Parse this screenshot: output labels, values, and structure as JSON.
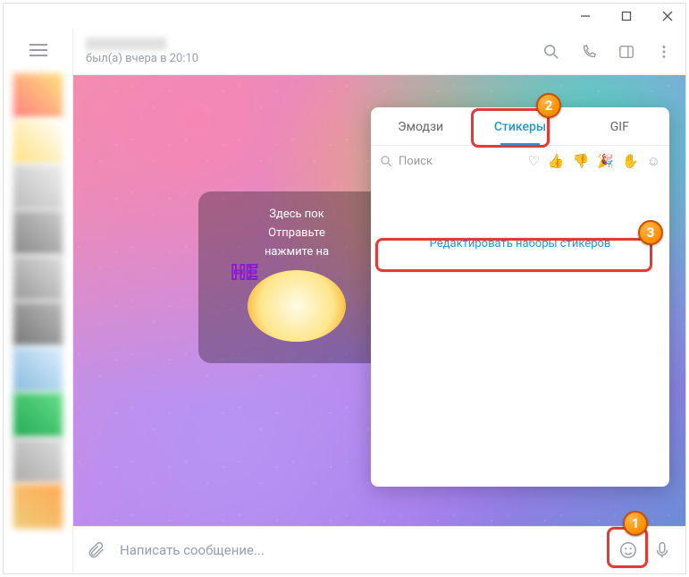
{
  "header": {
    "last_seen": "был(а) вчера в 20:10"
  },
  "center_card": {
    "line1": "Здесь пок",
    "line2": "Отправьте",
    "line3": "нажмите на",
    "sticker_label": "HE"
  },
  "sticker_panel": {
    "tabs": {
      "emoji": "Эмодзи",
      "stickers": "Стикеры",
      "gif": "GIF"
    },
    "search_placeholder": "Поиск",
    "edit_link": "Редактировать наборы стикеров"
  },
  "input": {
    "placeholder": "Написать сообщение..."
  },
  "annotations": {
    "b1": "1",
    "b2": "2",
    "b3": "3"
  }
}
